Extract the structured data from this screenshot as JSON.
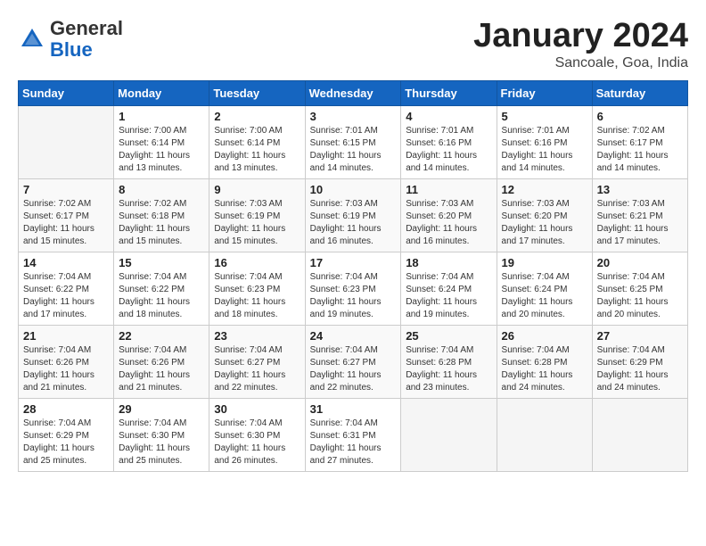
{
  "header": {
    "logo_general": "General",
    "logo_blue": "Blue",
    "title": "January 2024",
    "subtitle": "Sancoale, Goa, India"
  },
  "weekdays": [
    "Sunday",
    "Monday",
    "Tuesday",
    "Wednesday",
    "Thursday",
    "Friday",
    "Saturday"
  ],
  "weeks": [
    [
      {
        "day": "",
        "info": ""
      },
      {
        "day": "1",
        "info": "Sunrise: 7:00 AM\nSunset: 6:14 PM\nDaylight: 11 hours\nand 13 minutes."
      },
      {
        "day": "2",
        "info": "Sunrise: 7:00 AM\nSunset: 6:14 PM\nDaylight: 11 hours\nand 13 minutes."
      },
      {
        "day": "3",
        "info": "Sunrise: 7:01 AM\nSunset: 6:15 PM\nDaylight: 11 hours\nand 14 minutes."
      },
      {
        "day": "4",
        "info": "Sunrise: 7:01 AM\nSunset: 6:16 PM\nDaylight: 11 hours\nand 14 minutes."
      },
      {
        "day": "5",
        "info": "Sunrise: 7:01 AM\nSunset: 6:16 PM\nDaylight: 11 hours\nand 14 minutes."
      },
      {
        "day": "6",
        "info": "Sunrise: 7:02 AM\nSunset: 6:17 PM\nDaylight: 11 hours\nand 14 minutes."
      }
    ],
    [
      {
        "day": "7",
        "info": ""
      },
      {
        "day": "8",
        "info": "Sunrise: 7:02 AM\nSunset: 6:18 PM\nDaylight: 11 hours\nand 15 minutes."
      },
      {
        "day": "9",
        "info": "Sunrise: 7:03 AM\nSunset: 6:19 PM\nDaylight: 11 hours\nand 15 minutes."
      },
      {
        "day": "10",
        "info": "Sunrise: 7:03 AM\nSunset: 6:19 PM\nDaylight: 11 hours\nand 16 minutes."
      },
      {
        "day": "11",
        "info": "Sunrise: 7:03 AM\nSunset: 6:20 PM\nDaylight: 11 hours\nand 16 minutes."
      },
      {
        "day": "12",
        "info": "Sunrise: 7:03 AM\nSunset: 6:20 PM\nDaylight: 11 hours\nand 17 minutes."
      },
      {
        "day": "13",
        "info": "Sunrise: 7:03 AM\nSunset: 6:21 PM\nDaylight: 11 hours\nand 17 minutes."
      }
    ],
    [
      {
        "day": "14",
        "info": ""
      },
      {
        "day": "15",
        "info": "Sunrise: 7:04 AM\nSunset: 6:22 PM\nDaylight: 11 hours\nand 18 minutes."
      },
      {
        "day": "16",
        "info": "Sunrise: 7:04 AM\nSunset: 6:23 PM\nDaylight: 11 hours\nand 18 minutes."
      },
      {
        "day": "17",
        "info": "Sunrise: 7:04 AM\nSunset: 6:23 PM\nDaylight: 11 hours\nand 19 minutes."
      },
      {
        "day": "18",
        "info": "Sunrise: 7:04 AM\nSunset: 6:24 PM\nDaylight: 11 hours\nand 19 minutes."
      },
      {
        "day": "19",
        "info": "Sunrise: 7:04 AM\nSunset: 6:24 PM\nDaylight: 11 hours\nand 20 minutes."
      },
      {
        "day": "20",
        "info": "Sunrise: 7:04 AM\nSunset: 6:25 PM\nDaylight: 11 hours\nand 20 minutes."
      }
    ],
    [
      {
        "day": "21",
        "info": "Sunrise: 7:04 AM\nSunset: 6:26 PM\nDaylight: 11 hours\nand 21 minutes."
      },
      {
        "day": "22",
        "info": "Sunrise: 7:04 AM\nSunset: 6:26 PM\nDaylight: 11 hours\nand 21 minutes."
      },
      {
        "day": "23",
        "info": "Sunrise: 7:04 AM\nSunset: 6:27 PM\nDaylight: 11 hours\nand 22 minutes."
      },
      {
        "day": "24",
        "info": "Sunrise: 7:04 AM\nSunset: 6:27 PM\nDaylight: 11 hours\nand 22 minutes."
      },
      {
        "day": "25",
        "info": "Sunrise: 7:04 AM\nSunset: 6:28 PM\nDaylight: 11 hours\nand 23 minutes."
      },
      {
        "day": "26",
        "info": "Sunrise: 7:04 AM\nSunset: 6:28 PM\nDaylight: 11 hours\nand 24 minutes."
      },
      {
        "day": "27",
        "info": "Sunrise: 7:04 AM\nSunset: 6:29 PM\nDaylight: 11 hours\nand 24 minutes."
      }
    ],
    [
      {
        "day": "28",
        "info": "Sunrise: 7:04 AM\nSunset: 6:29 PM\nDaylight: 11 hours\nand 25 minutes."
      },
      {
        "day": "29",
        "info": "Sunrise: 7:04 AM\nSunset: 6:30 PM\nDaylight: 11 hours\nand 25 minutes."
      },
      {
        "day": "30",
        "info": "Sunrise: 7:04 AM\nSunset: 6:30 PM\nDaylight: 11 hours\nand 26 minutes."
      },
      {
        "day": "31",
        "info": "Sunrise: 7:04 AM\nSunset: 6:31 PM\nDaylight: 11 hours\nand 27 minutes."
      },
      {
        "day": "",
        "info": ""
      },
      {
        "day": "",
        "info": ""
      },
      {
        "day": "",
        "info": ""
      }
    ]
  ],
  "week1_day7_info": "Sunrise: 7:02 AM\nSunset: 6:17 PM\nDaylight: 11 hours\nand 15 minutes.",
  "week2_day14_info": "Sunrise: 7:04 AM\nSunset: 6:22 PM\nDaylight: 11 hours\nand 17 minutes."
}
